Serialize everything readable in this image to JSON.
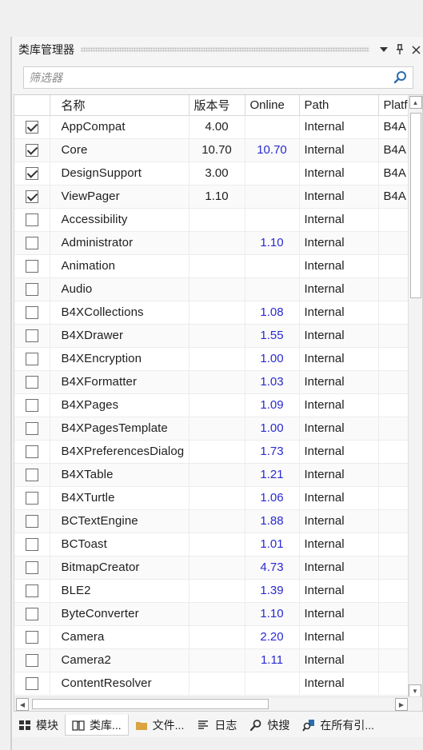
{
  "panel": {
    "title": "类库管理器",
    "filter_placeholder": "筛选器"
  },
  "columns": [
    "名称",
    "版本号",
    "Online",
    "Path",
    "Platf"
  ],
  "rows": [
    {
      "checked": true,
      "name": "AppCompat",
      "version": "4.00",
      "online": "",
      "path": "Internal",
      "platform": "B4A"
    },
    {
      "checked": true,
      "name": "Core",
      "version": "10.70",
      "online": "10.70",
      "path": "Internal",
      "platform": "B4A"
    },
    {
      "checked": true,
      "name": "DesignSupport",
      "version": "3.00",
      "online": "",
      "path": "Internal",
      "platform": "B4A"
    },
    {
      "checked": true,
      "name": "ViewPager",
      "version": "1.10",
      "online": "",
      "path": "Internal",
      "platform": "B4A"
    },
    {
      "checked": false,
      "name": "Accessibility",
      "version": "",
      "online": "",
      "path": "Internal",
      "platform": ""
    },
    {
      "checked": false,
      "name": "Administrator",
      "version": "",
      "online": "1.10",
      "path": "Internal",
      "platform": ""
    },
    {
      "checked": false,
      "name": "Animation",
      "version": "",
      "online": "",
      "path": "Internal",
      "platform": ""
    },
    {
      "checked": false,
      "name": "Audio",
      "version": "",
      "online": "",
      "path": "Internal",
      "platform": ""
    },
    {
      "checked": false,
      "name": "B4XCollections",
      "version": "",
      "online": "1.08",
      "path": "Internal",
      "platform": ""
    },
    {
      "checked": false,
      "name": "B4XDrawer",
      "version": "",
      "online": "1.55",
      "path": "Internal",
      "platform": ""
    },
    {
      "checked": false,
      "name": "B4XEncryption",
      "version": "",
      "online": "1.00",
      "path": "Internal",
      "platform": ""
    },
    {
      "checked": false,
      "name": "B4XFormatter",
      "version": "",
      "online": "1.03",
      "path": "Internal",
      "platform": ""
    },
    {
      "checked": false,
      "name": "B4XPages",
      "version": "",
      "online": "1.09",
      "path": "Internal",
      "platform": ""
    },
    {
      "checked": false,
      "name": "B4XPagesTemplate",
      "version": "",
      "online": "1.00",
      "path": "Internal",
      "platform": ""
    },
    {
      "checked": false,
      "name": "B4XPreferencesDialog",
      "version": "",
      "online": "1.73",
      "path": "Internal",
      "platform": ""
    },
    {
      "checked": false,
      "name": "B4XTable",
      "version": "",
      "online": "1.21",
      "path": "Internal",
      "platform": ""
    },
    {
      "checked": false,
      "name": "B4XTurtle",
      "version": "",
      "online": "1.06",
      "path": "Internal",
      "platform": ""
    },
    {
      "checked": false,
      "name": "BCTextEngine",
      "version": "",
      "online": "1.88",
      "path": "Internal",
      "platform": ""
    },
    {
      "checked": false,
      "name": "BCToast",
      "version": "",
      "online": "1.01",
      "path": "Internal",
      "platform": ""
    },
    {
      "checked": false,
      "name": "BitmapCreator",
      "version": "",
      "online": "4.73",
      "path": "Internal",
      "platform": ""
    },
    {
      "checked": false,
      "name": "BLE2",
      "version": "",
      "online": "1.39",
      "path": "Internal",
      "platform": ""
    },
    {
      "checked": false,
      "name": "ByteConverter",
      "version": "",
      "online": "1.10",
      "path": "Internal",
      "platform": ""
    },
    {
      "checked": false,
      "name": "Camera",
      "version": "",
      "online": "2.20",
      "path": "Internal",
      "platform": ""
    },
    {
      "checked": false,
      "name": "Camera2",
      "version": "",
      "online": "1.11",
      "path": "Internal",
      "platform": ""
    },
    {
      "checked": false,
      "name": "ContentResolver",
      "version": "",
      "online": "",
      "path": "Internal",
      "platform": ""
    }
  ],
  "tabs": [
    {
      "label": "模块",
      "icon": "modules-icon",
      "active": false
    },
    {
      "label": "类库...",
      "icon": "book-icon",
      "active": true
    },
    {
      "label": "文件...",
      "icon": "folder-icon",
      "active": false
    },
    {
      "label": "日志",
      "icon": "log-icon",
      "active": false
    },
    {
      "label": "快搜",
      "icon": "search-icon",
      "active": false
    },
    {
      "label": "在所有引...",
      "icon": "find-references-icon",
      "active": false
    }
  ],
  "colors": {
    "online_text": "#2a2ad0",
    "folder": "#d9a441",
    "search_icon": "#2b6cb0"
  }
}
